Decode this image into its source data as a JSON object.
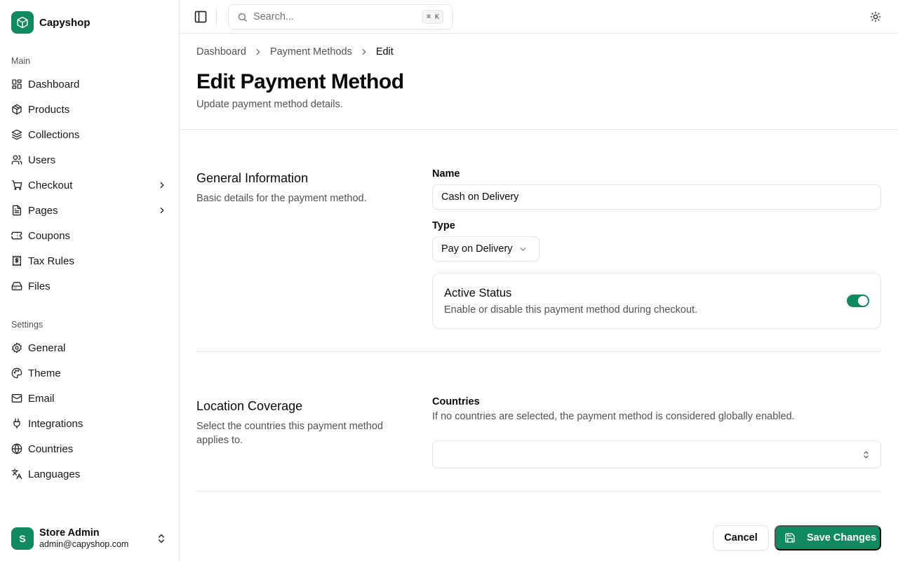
{
  "app": {
    "name": "Capyshop",
    "accent_color": "#0f8a5f"
  },
  "sidebar": {
    "groups": [
      {
        "label": "Main",
        "items": [
          {
            "label": "Dashboard",
            "icon": "layout-dashboard-icon"
          },
          {
            "label": "Products",
            "icon": "package-icon"
          },
          {
            "label": "Collections",
            "icon": "layers-icon"
          },
          {
            "label": "Users",
            "icon": "users-icon"
          },
          {
            "label": "Checkout",
            "icon": "shopping-cart-icon",
            "has_submenu": true
          },
          {
            "label": "Pages",
            "icon": "file-text-icon",
            "has_submenu": true
          },
          {
            "label": "Coupons",
            "icon": "ticket-icon"
          },
          {
            "label": "Tax Rules",
            "icon": "receipt-dollar-icon"
          },
          {
            "label": "Files",
            "icon": "hard-drive-icon"
          }
        ]
      },
      {
        "label": "Settings",
        "items": [
          {
            "label": "General",
            "icon": "settings-icon"
          },
          {
            "label": "Theme",
            "icon": "palette-icon"
          },
          {
            "label": "Email",
            "icon": "mail-icon"
          },
          {
            "label": "Integrations",
            "icon": "plug-icon"
          },
          {
            "label": "Countries",
            "icon": "globe-icon"
          },
          {
            "label": "Languages",
            "icon": "languages-icon"
          }
        ]
      }
    ],
    "user": {
      "initial": "S",
      "name": "Store Admin",
      "email": "admin@capyshop.com"
    }
  },
  "topbar": {
    "search_placeholder": "Search...",
    "shortcut": "⌘ K"
  },
  "breadcrumb": [
    "Dashboard",
    "Payment Methods",
    "Edit"
  ],
  "page": {
    "title": "Edit Payment Method",
    "subtitle": "Update payment method details."
  },
  "general": {
    "title": "General Information",
    "description": "Basic details for the payment method.",
    "name_label": "Name",
    "name_value": "Cash on Delivery",
    "type_label": "Type",
    "type_value": "Pay on Delivery",
    "status": {
      "title": "Active Status",
      "description": "Enable or disable this payment method during checkout.",
      "enabled": true
    }
  },
  "location": {
    "title": "Location Coverage",
    "description": "Select the countries this payment method applies to.",
    "countries_label": "Countries",
    "countries_help": "If no countries are selected, the payment method is considered globally enabled.",
    "countries_value": ""
  },
  "actions": {
    "cancel": "Cancel",
    "save": "Save Changes"
  }
}
